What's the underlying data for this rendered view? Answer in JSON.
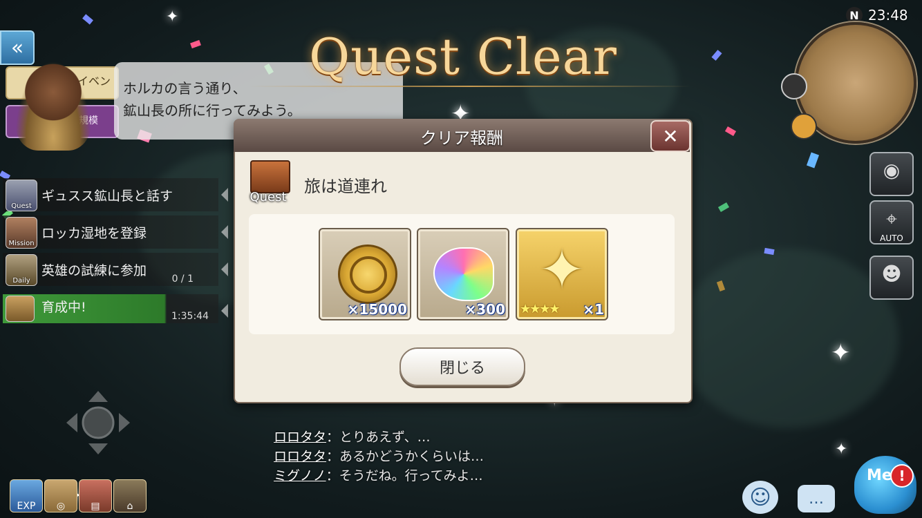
{
  "scene": {
    "title": "Quest Clear",
    "clock": "23:48",
    "compass": "N"
  },
  "npc_bubble": {
    "banner_text": "イベン",
    "banner2_text": "中規模",
    "text": "ホルカの言う通り、\n鉱山長の所に行ってみよう。"
  },
  "quest_list": [
    {
      "icon": "Quest",
      "label": "ギュスス鉱山長と話す",
      "progress": ""
    },
    {
      "icon": "Mission",
      "label": "ロッカ湿地を登録",
      "progress": ""
    },
    {
      "icon": "Daily",
      "label": "英雄の試練に参加",
      "progress": "0 / 1"
    },
    {
      "icon": "",
      "label": "育成中!",
      "progress": "1:35:44"
    }
  ],
  "dialog": {
    "title": "クリア報酬",
    "close_symbol": "✕",
    "quest_icon_label": "Quest",
    "quest_name": "旅は道連れ",
    "rewards": [
      {
        "type": "coin",
        "count": "×15000"
      },
      {
        "type": "rainbow-gem",
        "count": "×300"
      },
      {
        "type": "star-summon",
        "rarity": "★★★★",
        "count": "×1"
      }
    ],
    "close_button": "閉じる"
  },
  "chat": [
    {
      "name": "ロロタタ",
      "text": "：とりあえず、…"
    },
    {
      "name": "ロロタタ",
      "text": "：あるかどうかくらいは…"
    },
    {
      "name": "ミグノノ",
      "text": "：そうだね。行ってみよ…"
    }
  ],
  "bottom_left": {
    "exp_label": "EXP"
  },
  "right_buttons": {
    "auto_label": "AUTO"
  },
  "bottom_right": {
    "me_label": "Me",
    "alert": "!"
  }
}
